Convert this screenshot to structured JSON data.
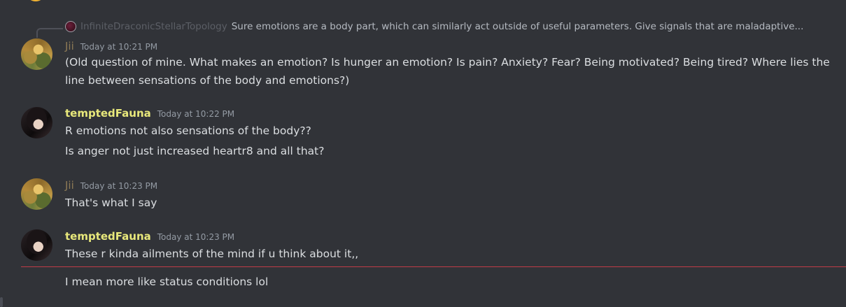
{
  "reply": {
    "author": "InfiniteDraconicStellarTopology",
    "text": "Sure emotions are a body part, which can similarly act outside of useful parameters. Give signals that are maladaptive..."
  },
  "messages": [
    {
      "author": "Jii",
      "timestamp": "Today at 10:21 PM",
      "lines": [
        "(Old question of mine. What makes an emotion? Is hunger an emotion? Is pain? Anxiety? Fear? Being motivated? Being tired? Where lies the line between sensations of the body and emotions?)"
      ]
    },
    {
      "author": "temptedFauna",
      "timestamp": "Today at 10:22 PM",
      "lines": [
        "R emotions not also sensations of the body??",
        "Is anger not just increased heartr8 and all that?"
      ]
    },
    {
      "author": "Jii",
      "timestamp": "Today at 10:23 PM",
      "lines": [
        "That's what I say"
      ]
    },
    {
      "author": "temptedFauna",
      "timestamp": "Today at 10:23 PM",
      "lines": [
        "These r kinda ailments of the mind if u think about it,,",
        "I mean more like status conditions lol"
      ]
    }
  ],
  "colors": {
    "background": "#313338",
    "jii_name": "#8d7a55",
    "fauna_name": "#e8e87b",
    "new_messages_divider": "#c03c48"
  }
}
